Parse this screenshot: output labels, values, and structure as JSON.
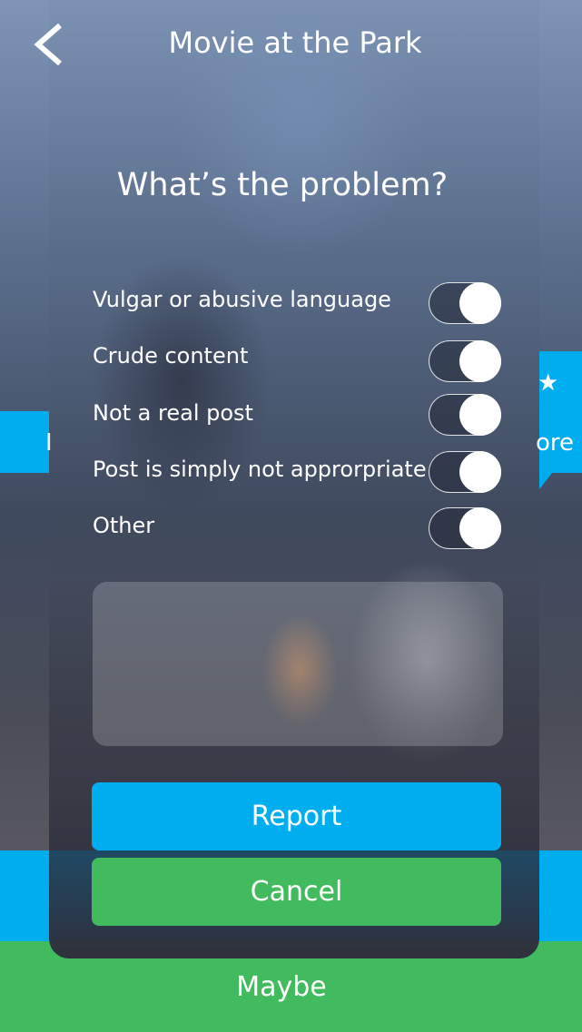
{
  "header": {
    "title": "Movie at the Park"
  },
  "dialog": {
    "question": "What’s the problem?",
    "options": [
      {
        "label": "Vulgar or abusive language",
        "enabled": true
      },
      {
        "label": "Crude content",
        "enabled": true
      },
      {
        "label": "Not a real post",
        "enabled": true
      },
      {
        "label": "Post is simply not approrpriate",
        "enabled": true
      },
      {
        "label": "Other",
        "enabled": true
      }
    ],
    "details_placeholder": "",
    "report_label": "Report",
    "cancel_label": "Cancel"
  },
  "background": {
    "left_button_text": "I",
    "right_button_icon": "star-icon",
    "right_button_text": "ore",
    "maybe_label": "Maybe"
  },
  "colors": {
    "blue": "#00adef",
    "green": "#41bb5e",
    "panel_dark": "#2f303d"
  }
}
